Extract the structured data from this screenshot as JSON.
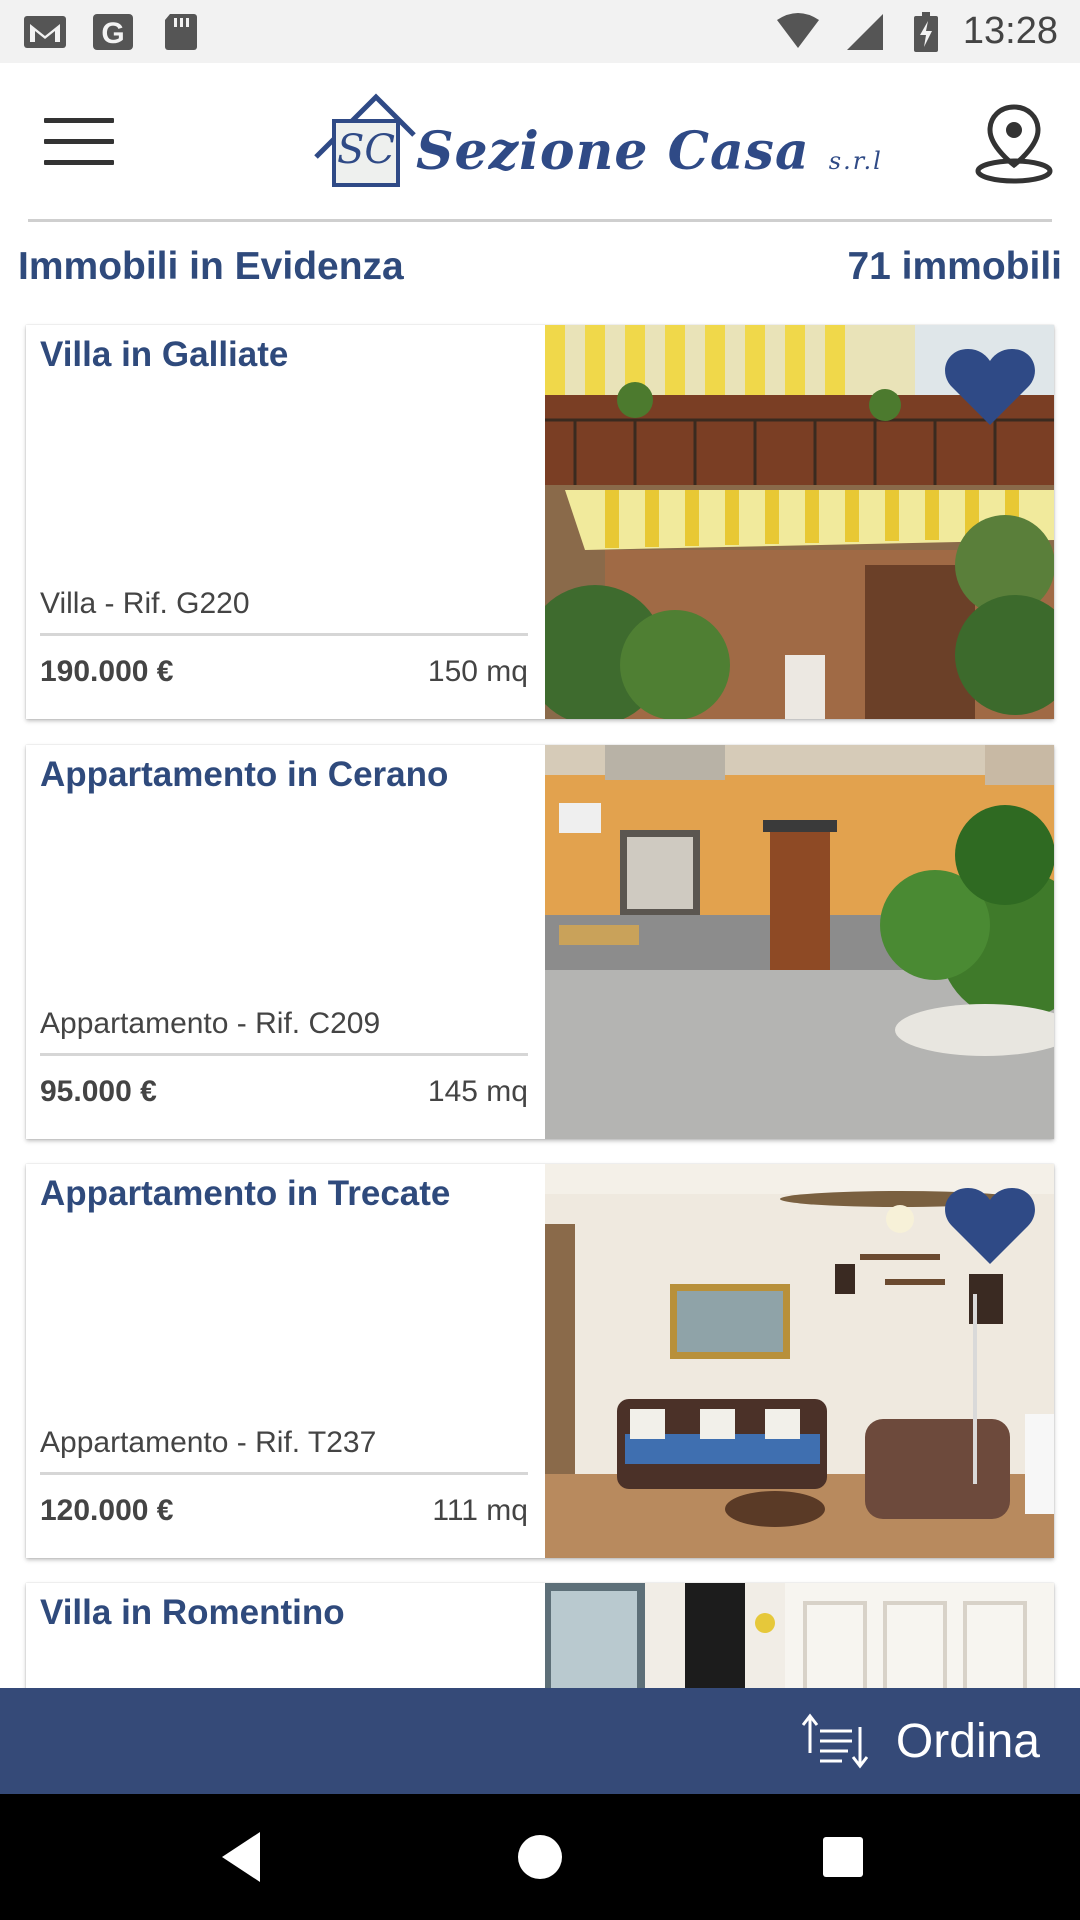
{
  "status_bar": {
    "time": "13:28",
    "left_icons": [
      "gmail-icon",
      "google-icon",
      "sd-card-icon"
    ],
    "right_icons": [
      "wifi-icon",
      "signal-icon",
      "battery-charging-icon"
    ]
  },
  "app_bar": {
    "logo_text": "Sezione Casa",
    "logo_suffix": "s.r.l",
    "logo_monogram": "SC",
    "menu_icon": "hamburger-menu-icon",
    "location_icon": "map-pin-icon"
  },
  "section": {
    "title": "Immobili in Evidenza",
    "count": "71 immobili"
  },
  "listings": [
    {
      "title": "Villa in Galliate",
      "type_ref": "Villa - Rif. G220",
      "price": "190.000 €",
      "area": "150 mq",
      "favorite": true
    },
    {
      "title": "Appartamento in Cerano",
      "type_ref": "Appartamento - Rif. C209",
      "price": "95.000 €",
      "area": "145 mq",
      "favorite": false
    },
    {
      "title": "Appartamento in Trecate",
      "type_ref": "Appartamento - Rif. T237",
      "price": "120.000 €",
      "area": "111 mq",
      "favorite": true
    },
    {
      "title": "Villa in Romentino",
      "type_ref": "",
      "price": "",
      "area": "",
      "favorite": false
    }
  ],
  "sort_bar": {
    "label": "Ordina",
    "icon": "sort-icon"
  },
  "nav_bar": {
    "buttons": [
      "back-icon",
      "home-icon",
      "recents-icon"
    ]
  },
  "colors": {
    "brand": "#2f4a7c",
    "sort_bar": "#354a78",
    "favorite": "#2f4a86"
  }
}
